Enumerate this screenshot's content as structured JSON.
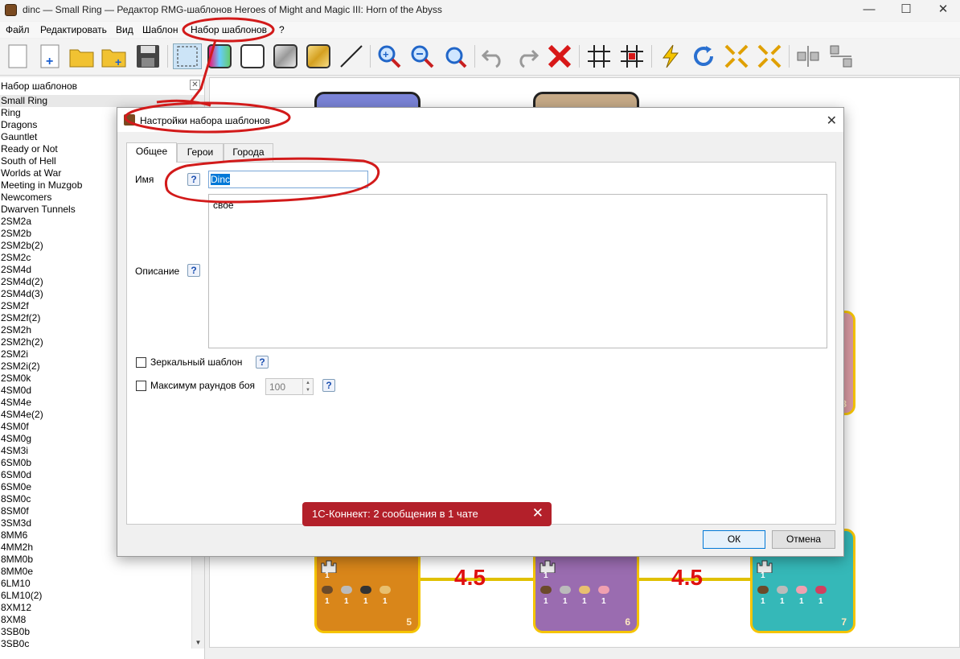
{
  "window": {
    "title": "dinc — Small Ring — Редактор RMG-шаблонов Heroes of Might and Magic III: Horn of the Abyss",
    "minimize": "—",
    "maximize": "☐",
    "close": "✕"
  },
  "menu": {
    "file": "Файл",
    "edit": "Редактировать",
    "view": "Вид",
    "template": "Шаблон",
    "templates_set": "Набор шаблонов",
    "help": "?"
  },
  "toolbar": {
    "icons": [
      "new-document-icon",
      "add-template-icon",
      "open-folder-icon",
      "add-folder-icon",
      "save-icon",
      "select-icon",
      "color-zone-icon",
      "white-zone-icon",
      "silver-zone-icon",
      "gold-zone-icon",
      "line-icon",
      "zoom-in-icon",
      "zoom-out-icon",
      "zoom-fit-icon",
      "undo-icon",
      "redo-icon",
      "delete-icon",
      "grid-icon",
      "grid-snap-icon",
      "lightning-icon",
      "refresh-icon",
      "shrink-icon",
      "expand-icon",
      "align-h-icon",
      "align-v-icon"
    ]
  },
  "panel": {
    "title": "Набор шаблонов",
    "close": "✕",
    "scroll_down": "▼",
    "templates": [
      "Small Ring",
      "Ring",
      "Dragons",
      "Gauntlet",
      "Ready or Not",
      "South of Hell",
      "Worlds at War",
      "Meeting in Muzgob",
      "Newcomers",
      "Dwarven Tunnels",
      "2SM2a",
      "2SM2b",
      "2SM2b(2)",
      "2SM2c",
      "2SM4d",
      "2SM4d(2)",
      "2SM4d(3)",
      "2SM2f",
      "2SM2f(2)",
      "2SM2h",
      "2SM2h(2)",
      "2SM2i",
      "2SM2i(2)",
      "2SM0k",
      "4SM0d",
      "4SM4e",
      "4SM4e(2)",
      "4SM0f",
      "4SM0g",
      "4SM3i",
      "6SM0b",
      "6SM0d",
      "6SM0e",
      "8SM0c",
      "8SM0f",
      "3SM3d",
      "8MM6",
      "4MM2h",
      "8MM0b",
      "8MM0e",
      "6LM10",
      "6LM10(2)",
      "8XM12",
      "8XM8",
      "3SB0b",
      "3SB0c"
    ],
    "selected": 0
  },
  "canvas": {
    "zones": [
      {
        "number": "5",
        "color": "#d9861a",
        "resources": [
          "1",
          "1",
          "1",
          "1",
          "1"
        ]
      },
      {
        "number": "6",
        "color": "#9a6cb0",
        "resources": [
          "1",
          "1",
          "1",
          "1",
          "1"
        ]
      },
      {
        "number": "7",
        "color": "#35b8b8",
        "resources": [
          "1",
          "1",
          "1",
          "1",
          "1"
        ]
      },
      {
        "number": "3",
        "color": "#d99aa3"
      }
    ],
    "connections": [
      "4.5",
      "4.5"
    ]
  },
  "dialog": {
    "title": "Настройки набора шаблонов",
    "close": "✕",
    "tabs": [
      "Общее",
      "Герои",
      "Города"
    ],
    "active_tab": 0,
    "name_label": "Имя",
    "name_value": "Dinc",
    "description_label": "Описание",
    "description_value": "свое",
    "help": "?",
    "mirror_label": "Зеркальный шаблон",
    "mirror_checked": false,
    "max_rounds_label": "Максимум раундов боя",
    "max_rounds_checked": false,
    "max_rounds_value": "100",
    "spin_up": "▲",
    "spin_down": "▼",
    "ok": "ОК",
    "cancel": "Отмена"
  },
  "toast": {
    "text": "1С-Коннект: 2 сообщения в 1 чате",
    "close": "✕",
    "color": "#b3202a"
  },
  "annotation_color": "#d21a1a"
}
